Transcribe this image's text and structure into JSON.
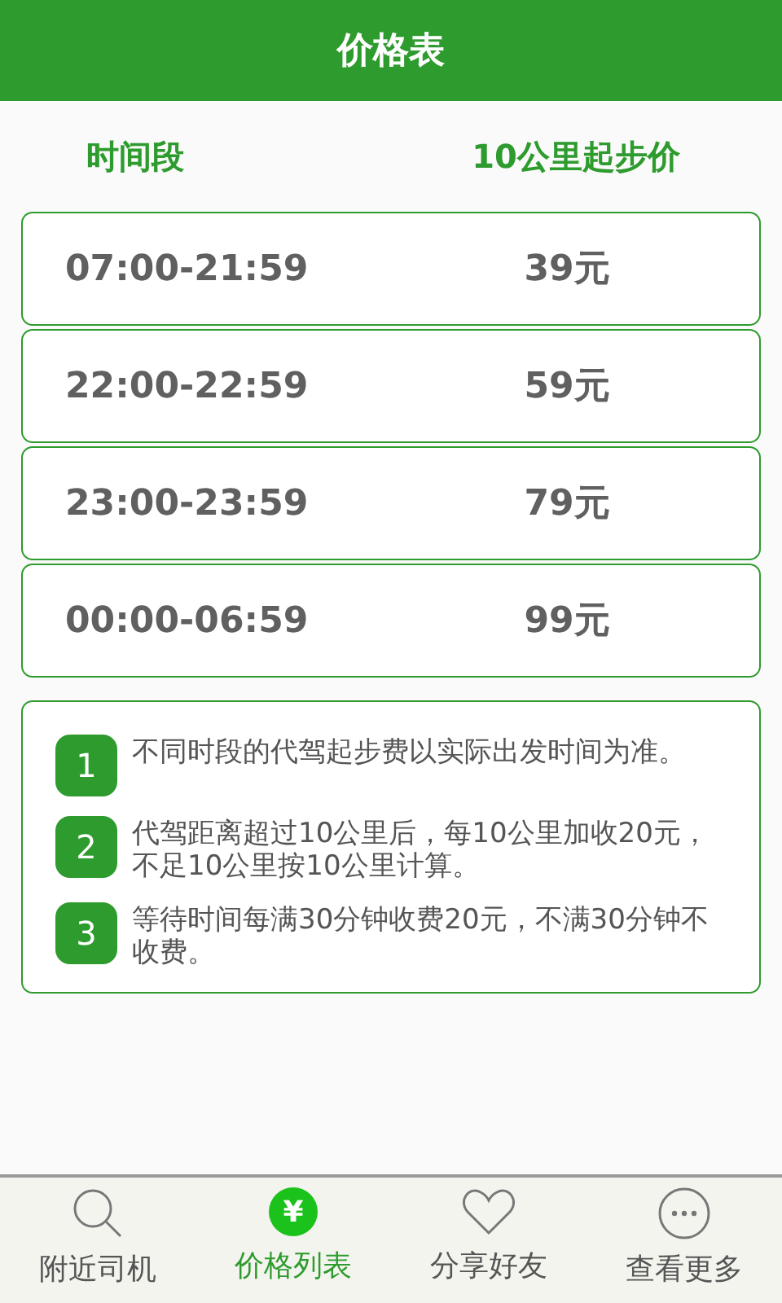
{
  "title": "价格表",
  "columns": [
    "时间段",
    "10公里起步价"
  ],
  "rows": [
    {
      "time": "07:00-21:59",
      "price": "39元"
    },
    {
      "time": "22:00-22:59",
      "price": "59元"
    },
    {
      "time": "23:00-23:59",
      "price": "79元"
    },
    {
      "time": "00:00-06:59",
      "price": "99元"
    }
  ],
  "notes": [
    {
      "number": "1",
      "text": "不同时段的代驾起步费以实际出发时间为准。"
    },
    {
      "number": "2",
      "text": "代驾距离超过10公里后，每10公里加收20元，不足10公里按10公里计算。"
    },
    {
      "number": "3",
      "text": "等待时间每满30分钟收费20元，不满30分钟不收费。"
    }
  ],
  "tabs": [
    {
      "label": "附近司机",
      "kind": "search",
      "selected": false
    },
    {
      "label": "价格列表",
      "kind": "price",
      "glyph": "¥",
      "selected": true
    },
    {
      "label": "分享好友",
      "kind": "heart",
      "selected": false
    },
    {
      "label": "查看更多",
      "kind": "more",
      "selected": false
    }
  ]
}
